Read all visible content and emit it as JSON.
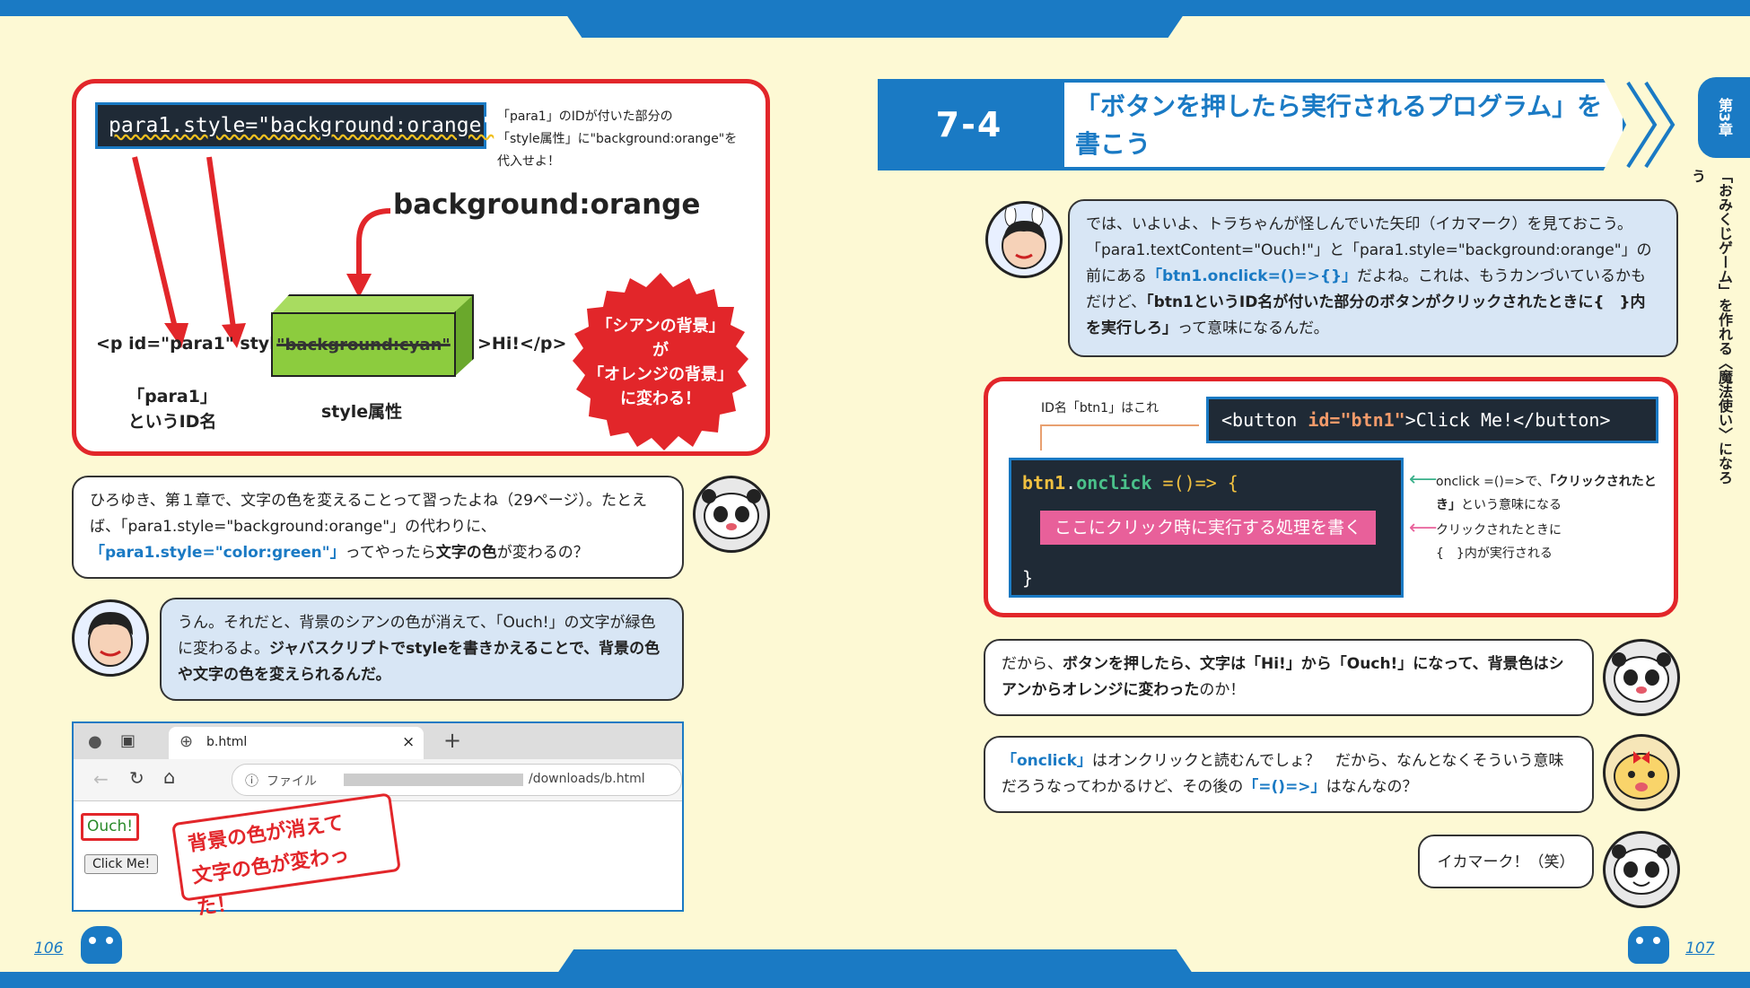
{
  "left": {
    "code1": "para1.style=\"background:orange\"",
    "note": [
      "「para1」のIDが付いた部分の",
      "「style属性」に\"background:orange\"を",
      "代入せよ！"
    ],
    "bg_orange": "background:orange",
    "p_open": "<p id=\"para1\" style=",
    "cyan_struck": "\"background:cyan\"",
    "p_close": ">Hi!</p>",
    "id_label": [
      "「para1」",
      "というID名"
    ],
    "style_label": "style属性",
    "burst": [
      "「シアンの背景」",
      "が",
      "「オレンジの背景」",
      "に変わる！"
    ],
    "bubble1": {
      "a": "ひろゆき、第１章で、文字の色を変えることって習ったよね（29ページ）。たとえば、「para1.style=\"background:orange\"」の代わりに、",
      "hl": "「para1.style=\"color:green\"」",
      "b": "ってやったら",
      "bold": "文字の色",
      "c": "が変わるの？"
    },
    "bubble2": {
      "a": "うん。それだと、背景のシアンの色が消えて、「Ouch!」の文字が緑色に変わるよ。",
      "bold": "ジャバスクリプトでstyleを書きかえることで、背景の色や文字の色を変えられるんだ。"
    },
    "browser": {
      "tab": "b.html",
      "close": "×",
      "plus": "+",
      "file": "ファイル",
      "url": "/downloads/b.html",
      "ouch": "Ouch!",
      "button": "Click Me!",
      "note": [
        "背景の色が消えて",
        "文字の色が変わった！"
      ]
    },
    "page_number": "106"
  },
  "right": {
    "section_num": "7-4",
    "section_title": [
      "「ボタンを押したら実行されるプログラム」を",
      "書こう"
    ],
    "chapter_tab": "第3章",
    "vertical_title": "「おみくじゲーム」を作れる〈魔法使い〉になろう",
    "bubble3": {
      "a": "では、いよいよ、トラちゃんが怪しんでいた矢印（イカマーク）を見ておこう。「para1.textContent=\"Ouch!\"」と「para1.style=\"background:orange\"」の前にある",
      "hl": "「btn1.onclick=()=>{}」",
      "b": "だよね。これは、もうカンづいているかもだけど、",
      "bold": "「btn1というID名が付いた部分のボタンがクリックされたときに{　}内を実行しろ」",
      "c": "って意味になるんだ。"
    },
    "diagram": {
      "id_note": "ID名「btn1」はこれ",
      "button_code": [
        "<button ",
        "id=\"btn1\"",
        ">Click Me!</button>"
      ],
      "onclick_code": [
        "btn1",
        ".",
        "onclick",
        " =()=> {"
      ],
      "pink": "ここにクリック時に実行する処理を書く",
      "close_brace": "}",
      "note1": [
        "onclick =()=>で、",
        "「クリックされたとき」",
        "という意味になる"
      ],
      "note2": [
        "クリックされたときに",
        "{　}内が実行される"
      ]
    },
    "bubble4": {
      "a": "だから、",
      "bold": "ボタンを押したら、文字は「Hi!」から「Ouch!」になって、背景色はシアンからオレンジに変わった",
      "b": "のか！"
    },
    "bubble5": {
      "hl": "「onclick」",
      "a": "はオンクリックと読むんでしょ？　だから、なんとなくそういう意味だろうなってわかるけど、その後の",
      "hl2": "「=()=>」",
      "b": "はなんなの？"
    },
    "bubble6": "イカマーク！（笑）",
    "page_number": "107"
  },
  "colors": {
    "accent": "#1a7ac4",
    "red": "#e2262a",
    "page": "#fdf9d4"
  }
}
